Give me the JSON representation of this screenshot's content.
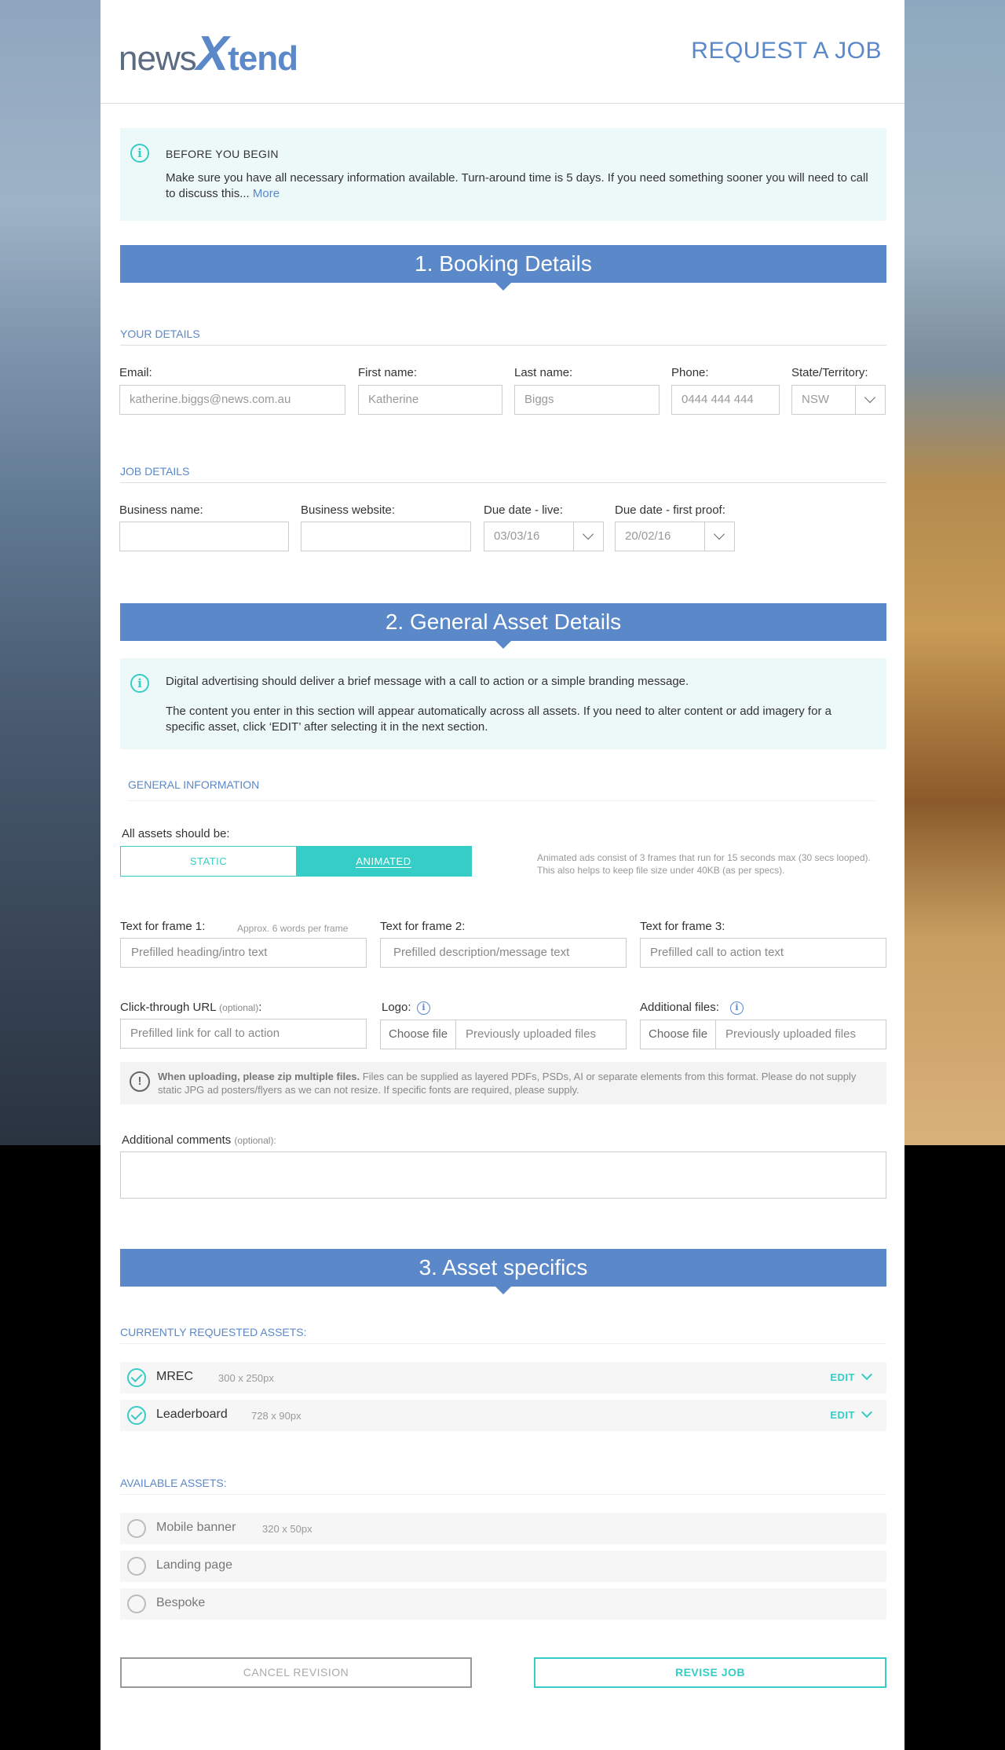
{
  "header": {
    "logo": {
      "part1": "news",
      "part2": "X",
      "part3": "tend"
    },
    "title": "REQUEST A JOB"
  },
  "intro_info": {
    "heading": "BEFORE YOU BEGIN",
    "text": "Make sure you have all necessary information available.  Turn-around time is 5 days. If you need something sooner you will need to call to discuss this... ",
    "more_link": "More"
  },
  "section1": {
    "title": "1. Booking Details",
    "your_details": {
      "heading": "YOUR DETAILS",
      "email": {
        "label": "Email:",
        "value": "katherine.biggs@news.com.au"
      },
      "first_name": {
        "label": "First name:",
        "value": "Katherine"
      },
      "last_name": {
        "label": "Last name:",
        "value": "Biggs"
      },
      "phone": {
        "label": "Phone:",
        "value": "0444 444 444"
      },
      "state": {
        "label": "State/Territory:",
        "value": "NSW"
      }
    },
    "job_details": {
      "heading": "JOB DETAILS",
      "business_name": {
        "label": "Business name:",
        "value": ""
      },
      "business_website": {
        "label": "Business website:",
        "value": ""
      },
      "due_live": {
        "label": "Due date - live:",
        "value": "03/03/16"
      },
      "due_proof": {
        "label": "Due date - first proof:",
        "value": "20/02/16"
      }
    }
  },
  "section2": {
    "title": "2. General Asset Details",
    "info_line1": "Digital advertising should deliver a brief message with a call to action or a simple branding message.",
    "info_line2": "The content you enter in this section will appear automatically across all assets. If you need to alter content or add imagery for a specific asset, click ‘EDIT’ after selecting it in the next section.",
    "general_heading": "GENERAL INFORMATION",
    "assets_label": "All assets should be:",
    "toggle_static": "STATIC",
    "toggle_animated": "ANIMATED",
    "toggle_selected": "ANIMATED",
    "animated_note": "Animated ads consist of 3 frames that run for 15 seconds max (30 secs looped). This also helps to keep file size under 40KB (as per specs).",
    "frame1": {
      "label": "Text for frame 1:",
      "hint": "Approx. 6 words per frame",
      "placeholder": "Prefilled heading/intro text"
    },
    "frame2": {
      "label": "Text for frame 2:",
      "placeholder": "Prefilled description/message text"
    },
    "frame3": {
      "label": "Text for frame 3:",
      "placeholder": "Prefilled  call to action text"
    },
    "click_url": {
      "label": "Click-through URL",
      "optional": "(optional)",
      "colon": ":",
      "placeholder": "Prefilled link for call to action"
    },
    "logo": {
      "label": "Logo:",
      "choose": "Choose file",
      "file": "Previously uploaded files"
    },
    "additional_files": {
      "label": "Additional files:",
      "choose": "Choose file",
      "file": "Previously uploaded files"
    },
    "warning_bold": "When uploading, please zip multiple files.",
    "warning_text": " Files can be supplied as layered PDFs, PSDs, AI or separate elements from this format. Please do not supply static JPG ad posters/flyers as we can not resize. If specific fonts are required, please supply.",
    "comments": {
      "label": "Additional comments",
      "optional": "(optional):"
    }
  },
  "section3": {
    "title": "3. Asset specifics",
    "requested_heading": "CURRENTLY REQUESTED ASSETS:",
    "requested": [
      {
        "name": "MREC",
        "size": "300 x 250px",
        "edit": "EDIT"
      },
      {
        "name": "Leaderboard",
        "size": "728 x 90px",
        "edit": "EDIT"
      }
    ],
    "available_heading": "AVAILABLE ASSETS:",
    "available": [
      {
        "name": "Mobile banner",
        "size": "320 x 50px"
      },
      {
        "name": "Landing page",
        "size": ""
      },
      {
        "name": "Bespoke",
        "size": ""
      }
    ]
  },
  "actions": {
    "cancel": "CANCEL REVISION",
    "revise": "REVISE JOB"
  },
  "colors": {
    "brand_blue": "#5b88c8",
    "accent_teal": "#35cdc6",
    "info_bg": "#edf8f8"
  }
}
